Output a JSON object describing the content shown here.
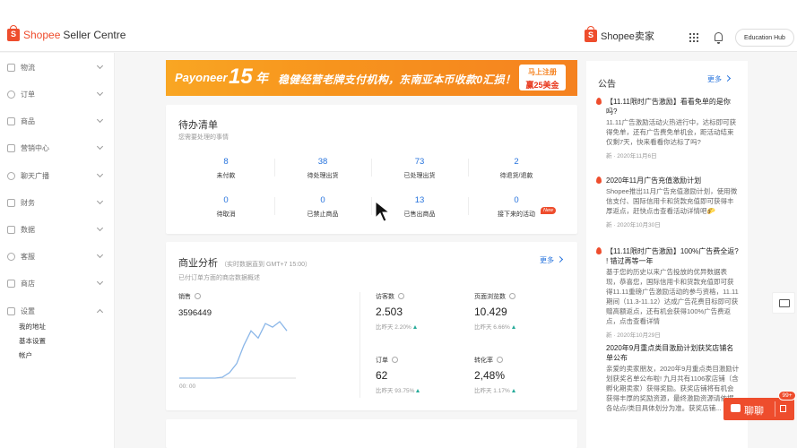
{
  "header": {
    "brand_name": "Shopee",
    "brand_sub": "Seller Centre",
    "seller_brand": "Shopee卖家",
    "education_hub": "Education Hub"
  },
  "sidebar": {
    "items": [
      {
        "label": "物流",
        "icon": "truck-icon"
      },
      {
        "label": "订单",
        "icon": "order-icon"
      },
      {
        "label": "商品",
        "icon": "product-icon"
      },
      {
        "label": "营销中心",
        "icon": "tag-icon"
      },
      {
        "label": "聊天广播",
        "icon": "chat-icon"
      },
      {
        "label": "财务",
        "icon": "wallet-icon"
      },
      {
        "label": "数据",
        "icon": "chart-icon"
      },
      {
        "label": "客服",
        "icon": "headset-icon"
      },
      {
        "label": "商店",
        "icon": "shop-icon"
      },
      {
        "label": "设置",
        "icon": "settings-icon"
      }
    ],
    "settings_sub": [
      "我的地址",
      "基本设置",
      "帐户"
    ]
  },
  "banner": {
    "logo": "Payoneer",
    "num": "15",
    "year": "年",
    "text": "稳健经营老牌支付机构，东南亚本币收款0汇损！",
    "cta_top": "马上注册",
    "cta_bottom": "赢25美金"
  },
  "todo": {
    "title": "待办清单",
    "subtitle": "您需要处理的事情",
    "items": [
      {
        "value": "8",
        "label": "未付款"
      },
      {
        "value": "38",
        "label": "待处理出货"
      },
      {
        "value": "73",
        "label": "已处理出货"
      },
      {
        "value": "2",
        "label": "待退货/退款"
      },
      {
        "value": "0",
        "label": "待取消"
      },
      {
        "value": "0",
        "label": "已禁止商品"
      },
      {
        "value": "13",
        "label": "已售出商品"
      },
      {
        "value": "0",
        "label": "接下来的活动"
      }
    ],
    "new_badge": "New"
  },
  "analytics": {
    "title": "商业分析",
    "realtime": "（实时数据直到 GMT+7 15:00）",
    "subtitle": "已付订单方面的商店数据概述",
    "more": "更多",
    "sales_label": "销售",
    "sales_value": "3596449",
    "chart_time": "00: 00",
    "metrics": [
      {
        "label": "访客数",
        "value": "2.503",
        "compare": "比昨天 2.20%"
      },
      {
        "label": "页面浏览数",
        "value": "10.429",
        "compare": "比昨天 6.66%"
      },
      {
        "label": "订单",
        "value": "62",
        "compare": "比昨天 93.75%"
      },
      {
        "label": "转化率",
        "value": "2,48%",
        "compare": "比昨天 1.17%"
      }
    ]
  },
  "chart_data": {
    "type": "line",
    "values": [
      0,
      0,
      0,
      0,
      0,
      0,
      0.5,
      3,
      8,
      18,
      26,
      22,
      30,
      28,
      31,
      26
    ]
  },
  "announcements": {
    "title": "公告",
    "more": "更多",
    "items": [
      {
        "title": "【11.11限时广告激励】看看免单的是你吗?",
        "body": "11.11广告激励活动火热进行中，达标即可获得免单，还有广告费免单机会，距活动结束仅剩7天，快来看看你达标了吗?",
        "date": "新 · 2020年11月6日",
        "hot": true
      },
      {
        "title": "2020年11月广告充值激励计划",
        "body": "Shopee推出11月广告充值激励计划，使用微信支付、国际信用卡和货款充值即可获得丰厚返点，赶快点击查看活动详情吧🌮",
        "date": "新 · 2020年10月30日",
        "hot": true
      },
      {
        "title": "【11.11限时广告激励】100%广告费全返? ! 错过再等一年",
        "body": "基于您的历史以来广告投放的优异数据表现，恭喜您，国际信用卡和货款充值即可获得11.11重磅广告激励活动的参与资格，11.11期间（11.3-11.12）达成广告花费目标即可获赠高额返点，还有机会获得100%广告费返点，点击查看详情",
        "date": "新 · 2020年10月29日",
        "hot": true
      },
      {
        "title": "2020年9月重点类目激励计划获奖店铺名单公布",
        "body": "亲爱的卖家朋友，2020年9月重点类目激励计划获奖名单公布啦! 九月共有1106家店铺（含孵化期卖家）获得奖励。获奖店铺将有机会获得丰厚的奖励资源，最终激励资源请依据各站点/类目具体划分为准。获奖店铺...",
        "date": "",
        "hot": false
      }
    ]
  },
  "chat": {
    "label": "聊聊",
    "badge": "99+"
  },
  "colors": {
    "brand": "#ee4d2d",
    "link": "#2673dd",
    "positive": "#26aa99",
    "chart_line": "#8ab6e8"
  }
}
